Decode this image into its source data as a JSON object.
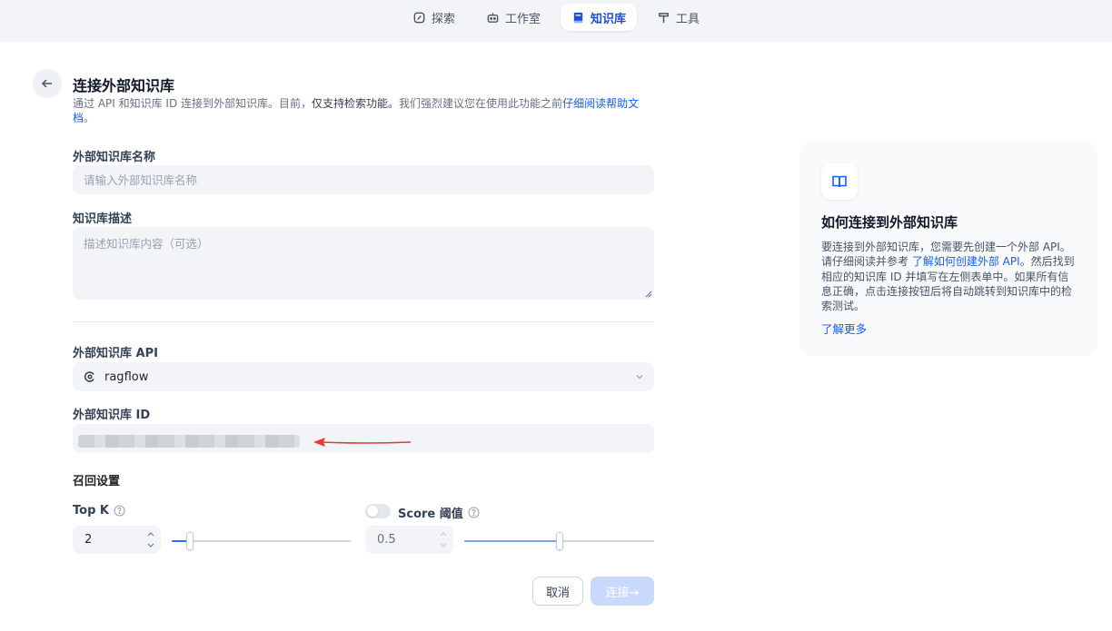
{
  "nav": {
    "items": [
      {
        "label": "探索",
        "icon": "explore-icon",
        "active": false
      },
      {
        "label": "工作室",
        "icon": "robot-icon",
        "active": false
      },
      {
        "label": "知识库",
        "icon": "book-icon",
        "active": true
      },
      {
        "label": "工具",
        "icon": "hammer-icon",
        "active": false
      }
    ]
  },
  "header": {
    "title": "连接外部知识库",
    "desc_prefix": "通过 API 和知识库 ID 连接到外部知识库。目前，",
    "desc_strong": "仅支持检索功能。",
    "desc_suffix": "我们强烈建议您在使用此功能之前",
    "desc_link": "仔细阅读帮助文档",
    "desc_end": "。"
  },
  "form": {
    "name_label": "外部知识库名称",
    "name_placeholder": "请输入外部知识库名称",
    "desc_label": "知识库描述",
    "desc_placeholder": "描述知识库内容（可选）",
    "api_label": "外部知识库 API",
    "api_value": "ragflow",
    "id_label": "外部知识库 ID",
    "recall_label": "召回设置",
    "topk_label": "Top K",
    "topk_value": "2",
    "topk_fraction": 0.1,
    "score_label": "Score 阈值",
    "score_value": "0.5",
    "score_enabled": false,
    "score_fraction": 0.5
  },
  "actions": {
    "cancel": "取消",
    "connect": "连接→"
  },
  "card": {
    "title": "如何连接到外部知识库",
    "body_1": "要连接到外部知识库，您需要先创建一个外部 API。请仔细阅读并参考 ",
    "body_link": "了解如何创建外部 API",
    "body_2": "。然后找到相应的知识库 ID 并填写在左侧表单中。如果所有信息正确，点击连接按钮后将自动跳转到知识库中的检索测试。",
    "more": "了解更多"
  },
  "colors": {
    "accent": "#155eef",
    "annotation_arrow": "#e53935"
  }
}
